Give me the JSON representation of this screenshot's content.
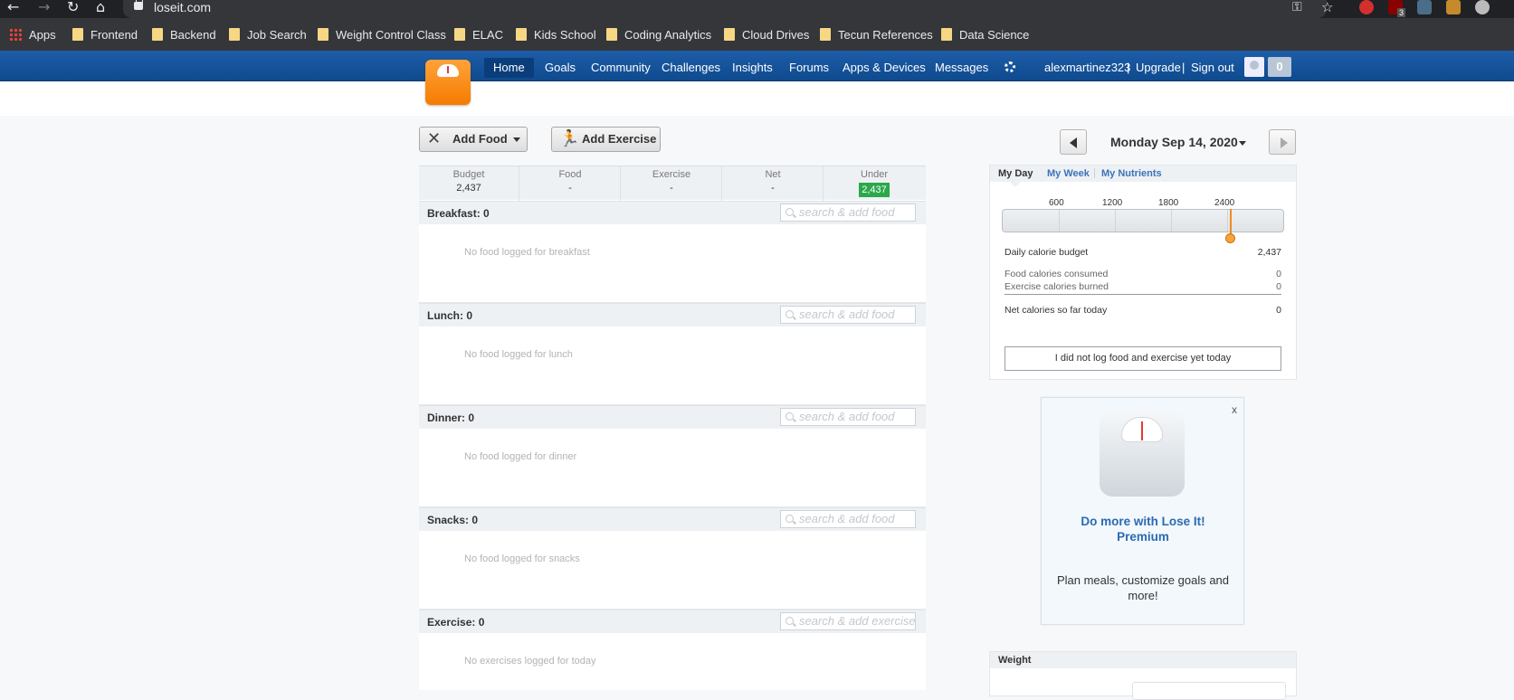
{
  "browser": {
    "url": "loseit.com",
    "ext_badge": "3",
    "bookmarks": [
      "Apps",
      "Frontend",
      "Backend",
      "Job Search",
      "Weight Control Class",
      "ELAC",
      "Kids School",
      "Coding Analytics",
      "Cloud Drives",
      "Tecun References",
      "Data Science"
    ]
  },
  "site_nav": {
    "items": [
      "Home",
      "Goals",
      "Community",
      "Challenges",
      "Insights",
      "Forums",
      "Apps & Devices",
      "Messages"
    ],
    "active": "Home",
    "username": "alexmartinez323",
    "upgrade": "Upgrade",
    "signout": "Sign out",
    "sep": "|",
    "notification_count": "0"
  },
  "toolbar": {
    "add_food": "Add Food",
    "add_exercise": "Add Exercise"
  },
  "summary": {
    "budget_label": "Budget",
    "budget_value": "2,437",
    "food_label": "Food",
    "food_value": "-",
    "exercise_label": "Exercise",
    "exercise_value": "-",
    "net_label": "Net",
    "net_value": "-",
    "under_label": "Under",
    "under_value": "2,437"
  },
  "meals": [
    {
      "title": "Breakfast: 0",
      "placeholder": "search & add food",
      "empty": "No food logged for breakfast"
    },
    {
      "title": "Lunch: 0",
      "placeholder": "search & add food",
      "empty": "No food logged for lunch"
    },
    {
      "title": "Dinner: 0",
      "placeholder": "search & add food",
      "empty": "No food logged for dinner"
    },
    {
      "title": "Snacks: 0",
      "placeholder": "search & add food",
      "empty": "No food logged for snacks"
    },
    {
      "title": "Exercise: 0",
      "placeholder": "search & add exercise",
      "empty": "No exercises logged for today"
    }
  ],
  "date": {
    "label": "Monday Sep 14, 2020"
  },
  "day_panel": {
    "tabs": [
      "My Day",
      "My Week",
      "My Nutrients"
    ],
    "active_tab": "My Day",
    "scale_labels": [
      "600",
      "1200",
      "1800",
      "2400"
    ],
    "needle_value": 2437,
    "rows": [
      {
        "label": "Daily calorie budget",
        "value": "2,437"
      },
      {
        "label": "Food calories consumed",
        "value": "0"
      },
      {
        "label": "Exercise calories burned",
        "value": "0"
      },
      {
        "label": "Net calories so far today",
        "value": "0"
      }
    ],
    "log_button": "I did not log food and exercise yet today"
  },
  "promo": {
    "close": "x",
    "title": "Do more with Lose It! Premium",
    "text": "Plan meals, customize goals and more!"
  },
  "weight": {
    "title": "Weight"
  },
  "colors": {
    "nav_blue": "#1d5da8",
    "logo_orange": "#f57c00",
    "under_green": "#2aa84a",
    "link_blue": "#3b73b9"
  }
}
